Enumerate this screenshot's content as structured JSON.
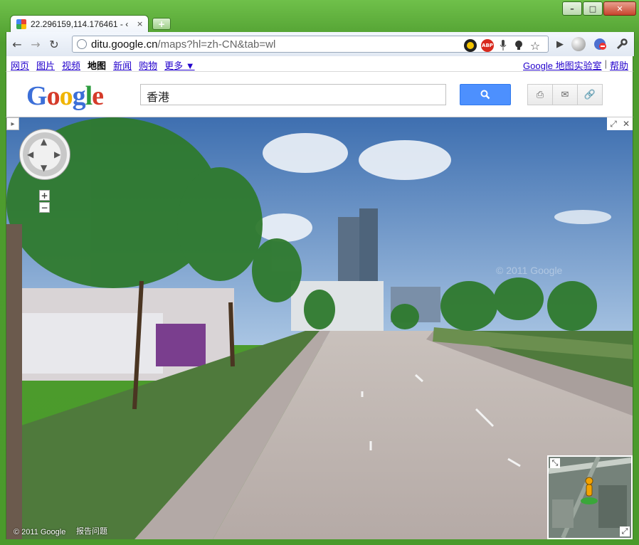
{
  "window": {
    "minimize": "–",
    "maximize": "□",
    "close": "✕"
  },
  "tab": {
    "title": "22.296159,114.176461 - ‹",
    "close": "×",
    "new_tab": "+"
  },
  "toolbar": {
    "back": "←",
    "forward": "→",
    "refresh": "↻",
    "url_host": "ditu.google.cn",
    "url_path": "/maps?hl=zh-CN&tab=wl",
    "star": "☆",
    "abp_label": "ABP",
    "play": "▶",
    "wrench": "🔧"
  },
  "google_bar": {
    "links": [
      "网页",
      "图片",
      "视频",
      "地图",
      "新闻",
      "购物",
      "更多 ▼"
    ],
    "active_index": 3,
    "labs": "Google 地图实验室",
    "separator": "|",
    "help": "帮助"
  },
  "header": {
    "logo": [
      "G",
      "o",
      "o",
      "g",
      "l",
      "e"
    ],
    "search_value": "香港",
    "print": "⎙",
    "email": "✉",
    "link": "🔗"
  },
  "streetview": {
    "collapse": "▸",
    "expand": "⤢",
    "close": "✕",
    "zoom_in": "+",
    "zoom_out": "−",
    "nav_up": "▲",
    "nav_down": "▼",
    "nav_left": "◀",
    "nav_right": "▶",
    "copyright": "© 2011 Google",
    "report": "报告问题",
    "watermark": "© 2011 Google",
    "minimap_expand": "⤡",
    "minimap_collapse": "⤢"
  },
  "colors": {
    "frame": "#4f9d2f",
    "link": "#2200cc",
    "search_button": "#4d90fe"
  }
}
